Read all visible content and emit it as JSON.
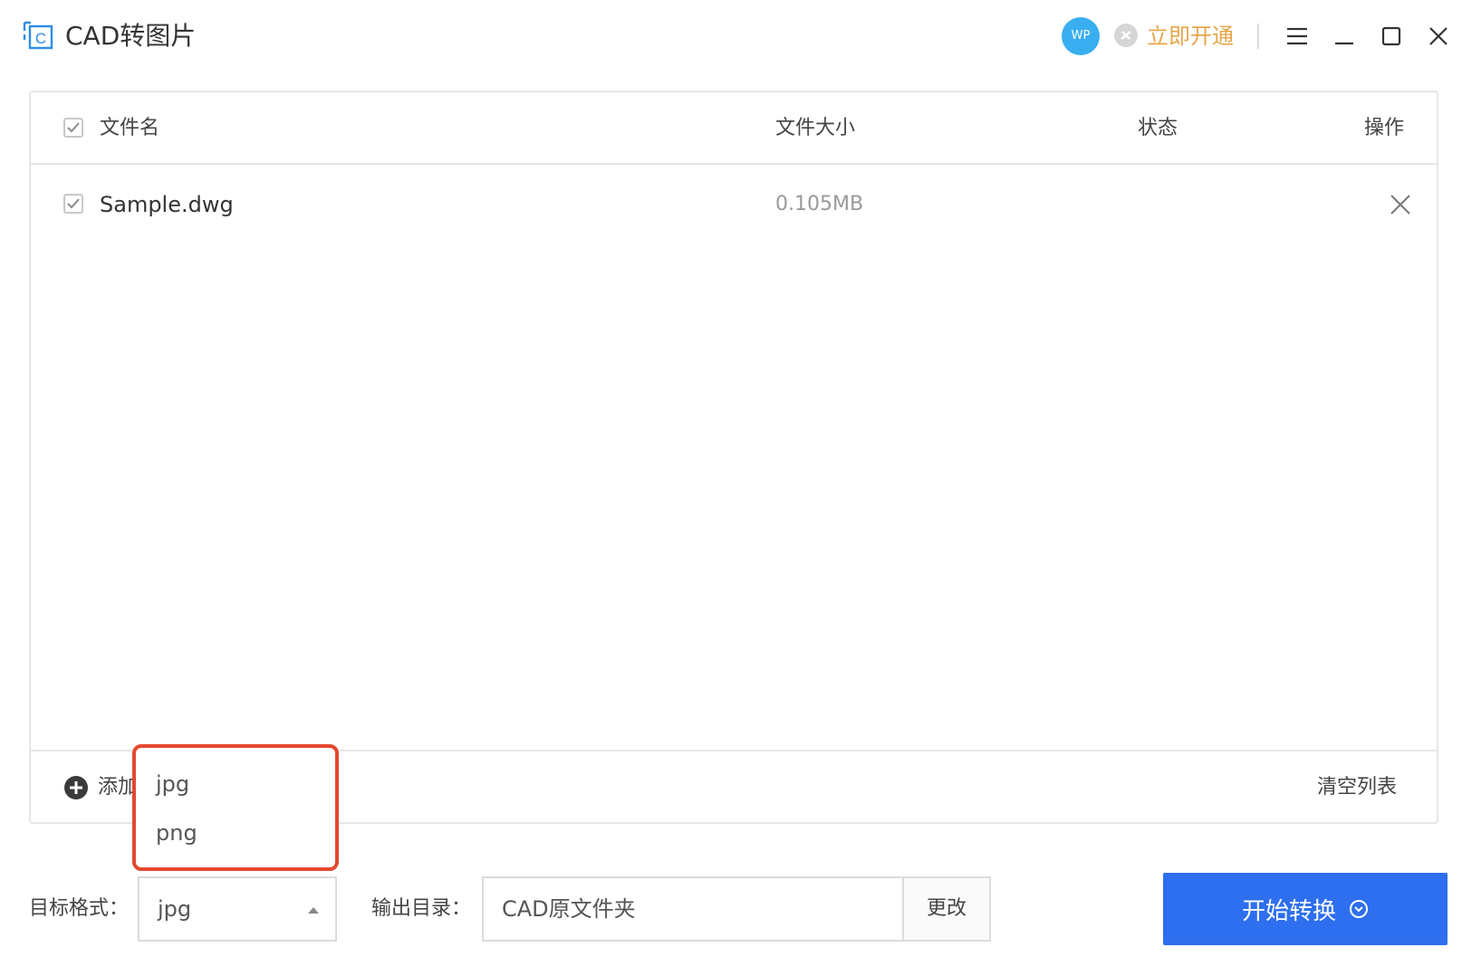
{
  "app": {
    "title": "CAD转图片",
    "avatar_text": "WP",
    "vip_link": "立即开通"
  },
  "table": {
    "headers": {
      "name": "文件名",
      "size": "文件大小",
      "status": "状态",
      "actions": "操作"
    },
    "rows": [
      {
        "name": "Sample.dwg",
        "size": "0.105MB",
        "status": "",
        "checked": true
      }
    ]
  },
  "footer": {
    "add_label": "添加",
    "clear_label": "清空列表"
  },
  "dropdown": {
    "options": [
      "jpg",
      "png"
    ]
  },
  "controls": {
    "format_label": "目标格式：",
    "format_value": "jpg",
    "output_label": "输出目录：",
    "output_value": "CAD原文件夹",
    "change_label": "更改",
    "start_label": "开始转换"
  },
  "colors": {
    "primary": "#2e6fef",
    "vip": "#e6a64a",
    "highlight": "#e4482d",
    "avatar": "#38aef0"
  }
}
